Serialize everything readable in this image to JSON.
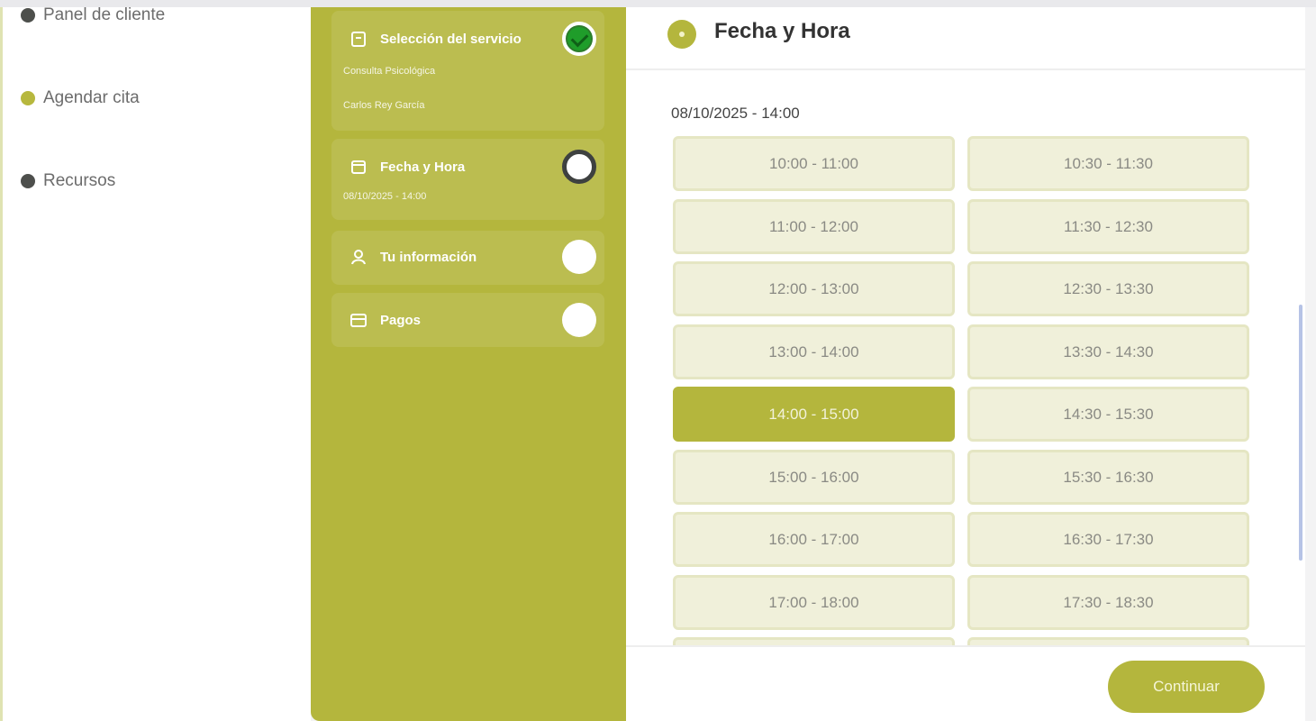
{
  "nav": {
    "items": [
      {
        "label": "Panel de cliente",
        "dot_color": "#4d4f4c"
      },
      {
        "label": "Agendar cita",
        "dot_color": "#b7b83e"
      },
      {
        "label": "Recursos",
        "dot_color": "#4d4f4c"
      }
    ]
  },
  "steps": [
    {
      "title": "Selección del servicio",
      "subtitles": [
        "Consulta Psicológica",
        "Carlos Rey García"
      ],
      "icon": "clipboard-icon",
      "status": "done"
    },
    {
      "title": "Fecha y Hora",
      "subtitles": [
        "08/10/2025 - 14:00"
      ],
      "icon": "calendar-icon",
      "status": "current"
    },
    {
      "title": "Tu información",
      "subtitles": [],
      "icon": "user-icon",
      "status": "pending"
    },
    {
      "title": "Pagos",
      "subtitles": [],
      "icon": "card-icon",
      "status": "pending"
    }
  ],
  "main": {
    "header_title": "Fecha y Hora",
    "selected_datetime": "08/10/2025 - 14:00",
    "slots": [
      {
        "label": "10:00 - 11:00",
        "selected": false
      },
      {
        "label": "10:30 - 11:30",
        "selected": false
      },
      {
        "label": "11:00 - 12:00",
        "selected": false
      },
      {
        "label": "11:30 - 12:30",
        "selected": false
      },
      {
        "label": "12:00 - 13:00",
        "selected": false
      },
      {
        "label": "12:30 - 13:30",
        "selected": false
      },
      {
        "label": "13:00 - 14:00",
        "selected": false
      },
      {
        "label": "13:30 - 14:30",
        "selected": false
      },
      {
        "label": "14:00 - 15:00",
        "selected": true
      },
      {
        "label": "14:30 - 15:30",
        "selected": false
      },
      {
        "label": "15:00 - 16:00",
        "selected": false
      },
      {
        "label": "15:30 - 16:30",
        "selected": false
      },
      {
        "label": "16:00 - 17:00",
        "selected": false
      },
      {
        "label": "16:30 - 17:30",
        "selected": false
      },
      {
        "label": "17:00 - 18:00",
        "selected": false
      },
      {
        "label": "17:30 - 18:30",
        "selected": false
      },
      {
        "label": "",
        "selected": false
      },
      {
        "label": "",
        "selected": false
      }
    ],
    "continue_label": "Continuar"
  },
  "colors": {
    "accent": "#b4b63d",
    "slot_bg": "#f0f0da",
    "done": "#1f9d2a"
  }
}
